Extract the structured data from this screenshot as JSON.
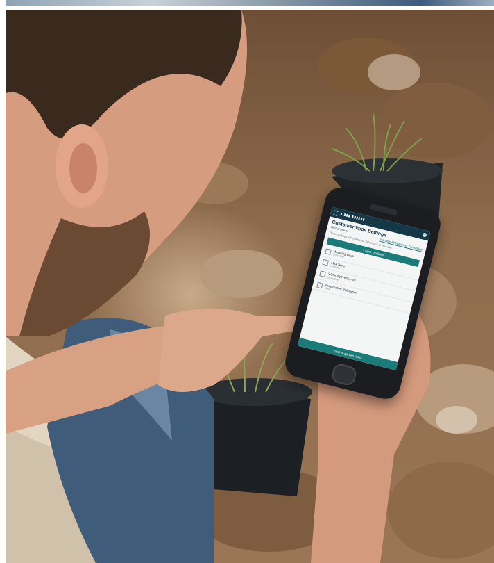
{
  "photo": {
    "description_colors": {
      "soil": "#8a6a4d",
      "shirt": "#e2d6c2",
      "jeans": "#3f5c7a",
      "skin": "#d9a184",
      "hair": "#3a2a1e",
      "pot": "#1f2326",
      "grass": "#7ea04a",
      "phone": "#1b1d20",
      "app_accent": "#1b7b78",
      "app_header": "#143848"
    }
  },
  "phone_app": {
    "title": "Customer Wide Settings",
    "subtitle_left": "Global alarm",
    "subtitle_link": "Manage all Watering Schedules",
    "note": "These settings will change all Schedules at your site.",
    "action_bar": "+  Sync Updates",
    "rows": [
      {
        "label": "Watering Days",
        "sub": "Every Day"
      },
      {
        "label": "Max Temp",
        "sub": "Unlimited"
      },
      {
        "label": "Watering Frequency",
        "sub": "Every Day"
      },
      {
        "label": "Evaporation Rebalance",
        "sub": "None"
      }
    ],
    "bottom_bar": "Back to garden tasks"
  }
}
